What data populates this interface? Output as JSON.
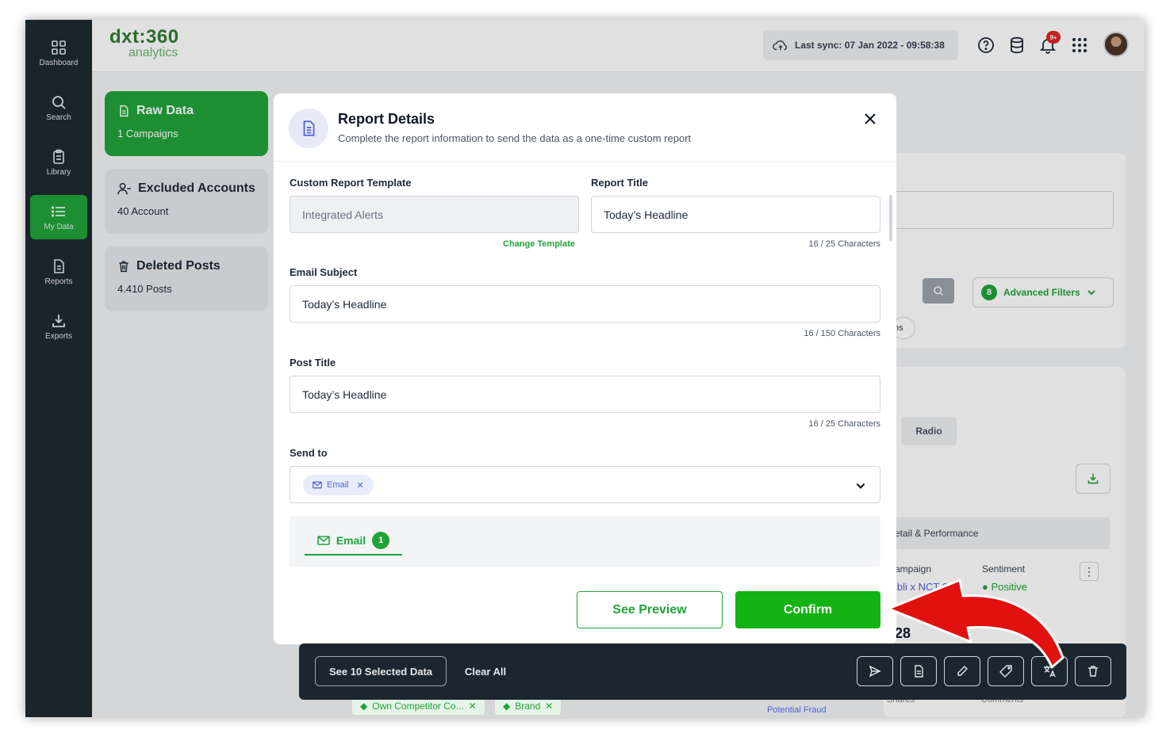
{
  "rail": {
    "items": [
      {
        "label": "Dashboard",
        "icon": "dashboard-grid-icon"
      },
      {
        "label": "Search",
        "icon": "search-icon"
      },
      {
        "label": "Library",
        "icon": "clipboard-icon"
      },
      {
        "label": "My Data",
        "icon": "list-icon"
      },
      {
        "label": "Reports",
        "icon": "document-icon"
      },
      {
        "label": "Exports",
        "icon": "download-icon"
      }
    ],
    "active": "My Data"
  },
  "header": {
    "logo_main": "dxt:360",
    "logo_sub": "analytics",
    "last_sync": "Last sync: 07 Jan 2022 - 09:58:38",
    "notification_badge": "9+"
  },
  "left_cards": [
    {
      "title": "Raw Data",
      "subtitle": "1 Campaigns"
    },
    {
      "title": "Excluded Accounts",
      "subtitle": "40 Account"
    },
    {
      "title": "Deleted Posts",
      "subtitle": "4.410 Posts"
    }
  ],
  "background": {
    "advanced_filters_count": "8",
    "advanced_filters_label": "Advanced Filters",
    "chip_fragment": "ns",
    "radio_tab": "Radio",
    "detail_header": "etail & Performance",
    "col_campaign": "ampaign",
    "col_sentiment": "Sentiment",
    "campaign_link": "ibli x NCT 28",
    "sentiment_value": "Positive",
    "number_fragment": "28",
    "tags": [
      "Own Competitor Co...",
      "Brand"
    ],
    "tag_potential": "Potential Fraud",
    "footer_shares": "Shares",
    "footer_comments": "Comments"
  },
  "modal": {
    "title": "Report Details",
    "subtitle": "Complete the report information to send the data as a one-time custom report",
    "template_label": "Custom Report Template",
    "template_value": "Integrated Alerts",
    "change_template": "Change Template",
    "report_title_label": "Report Title",
    "report_title_value": "Today’s Headline",
    "report_title_count": "16 / 25 Characters",
    "email_subject_label": "Email Subject",
    "email_subject_value": "Today’s Headline",
    "email_subject_count": "16 / 150 Characters",
    "post_title_label": "Post Title",
    "post_title_value": "Today’s Headline",
    "post_title_count": "16 / 25 Characters",
    "send_to_label": "Send to",
    "send_to_chip": "Email",
    "tab_label": "Email",
    "tab_count": "1",
    "preview_button": "See Preview",
    "confirm_button": "Confirm"
  },
  "action_bar": {
    "see_selected": "See 10 Selected Data",
    "clear_all": "Clear All",
    "icons": [
      "send-icon",
      "file-icon",
      "edit-icon",
      "tag-icon",
      "translate-icon",
      "trash-icon"
    ]
  },
  "colors": {
    "brand_green": "#22a33a",
    "confirm_green": "#12b312",
    "rail_bg": "#1e2a32",
    "arrow_red": "#e0110f"
  }
}
